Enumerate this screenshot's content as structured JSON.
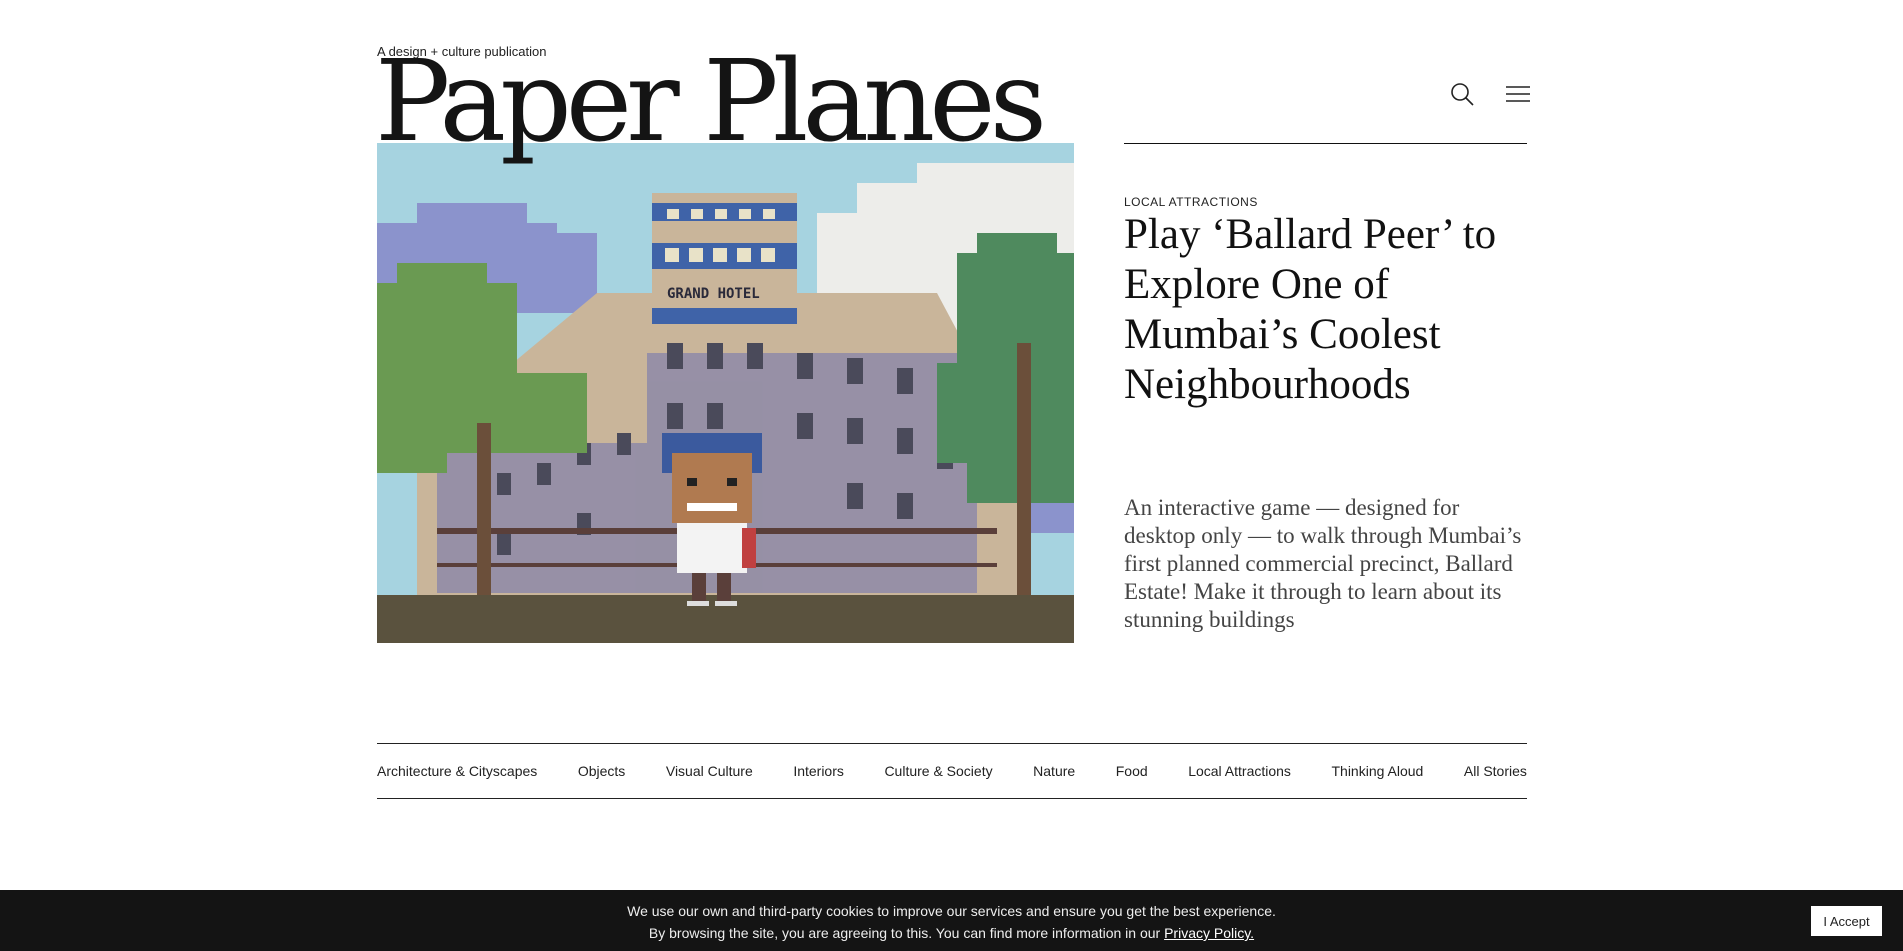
{
  "header": {
    "tagline": "A design + culture publication",
    "logo": "Paper Planes"
  },
  "icons": {
    "search": "search-icon",
    "menu": "hamburger-menu-icon"
  },
  "feature": {
    "kicker": "LOCAL ATTRACTIONS",
    "headline": "Play ‘Ballard Peer’ to Explore One of Mumbai’s Coolest Neighbourhoods",
    "dek": "An interactive game — designed for desktop only — to walk through Mumbai’s first planned commercial precinct, Ballard Estate! Make it through to learn about its stunning buildings",
    "image_sign": "GRAND HOTEL"
  },
  "categories": [
    "Architecture & Cityscapes",
    "Objects",
    "Visual Culture",
    "Interiors",
    "Culture & Society",
    "Nature",
    "Food",
    "Local Attractions",
    "Thinking Aloud",
    "All Stories"
  ],
  "cookie": {
    "line1": "We use our own and third-party cookies to improve our services and ensure you get the best experience.",
    "line2": "By browsing the site, you are agreeing to this. You can find more information in our ",
    "link": "Privacy Policy.",
    "accept": "I Accept"
  },
  "colors": {
    "cookie_bar": "#141414",
    "sky": "#a6d3e0",
    "ground": "#5a523e"
  }
}
